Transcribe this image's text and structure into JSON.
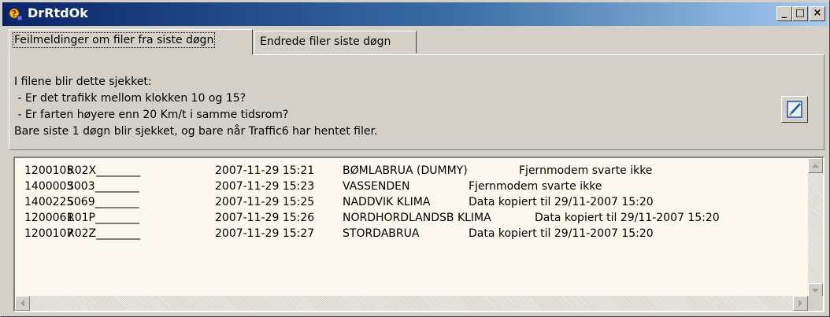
{
  "window": {
    "title": "DrRtdOk"
  },
  "titlebar_buttons": {
    "minimize": "_",
    "maximize": "□",
    "close": "×"
  },
  "tabs": [
    {
      "label": "Feilmeldinger om filer fra siste døgn",
      "active": true
    },
    {
      "label": "Endrede filer siste døgn",
      "active": false
    }
  ],
  "info": {
    "lines": [
      "I filene blir dette sjekket:",
      " - Er det trafikk mellom klokken 10 og 15?",
      " - Er farten høyere enn 20 Km/t i samme tidsrom?",
      "Bare siste 1 døgn blir sjekket, og bare når Traffic6 har hentet filer."
    ]
  },
  "icons": {
    "app": "key-question-icon",
    "edit": "edit-pencil-icon"
  },
  "list": {
    "rows": [
      {
        "id": "1200105",
        "code": "R02X________",
        "time": "2007-11-29 15:21",
        "name": "BØMLABRUA (DUMMY)",
        "message": "Fjernmodem svarte ikke"
      },
      {
        "id": "1400003",
        "code": "S003________",
        "time": "2007-11-29 15:23",
        "name": "VASSENDEN",
        "message": "Fjernmodem svarte ikke"
      },
      {
        "id": "1400225",
        "code": "S069________",
        "time": "2007-11-29 15:25",
        "name": "NADDVIK KLIMA",
        "message": "Data kopiert til 29/11-2007 15:20"
      },
      {
        "id": "1200061",
        "code": "R01P________",
        "time": "2007-11-29 15:26",
        "name": "NORDHORDLANDSB KLIMA",
        "message": "Data kopiert til 29/11-2007 15:20"
      },
      {
        "id": "1200107",
        "code": "R02Z________",
        "time": "2007-11-29 15:27",
        "name": "STORDABRUA",
        "message": "Data kopiert til 29/11-2007 15:20"
      }
    ]
  },
  "colors": {
    "titlebar_start": "#0a246a",
    "titlebar_end": "#a6caf0",
    "face": "#d4d0c8",
    "list_bg": "#fdf8ee"
  }
}
